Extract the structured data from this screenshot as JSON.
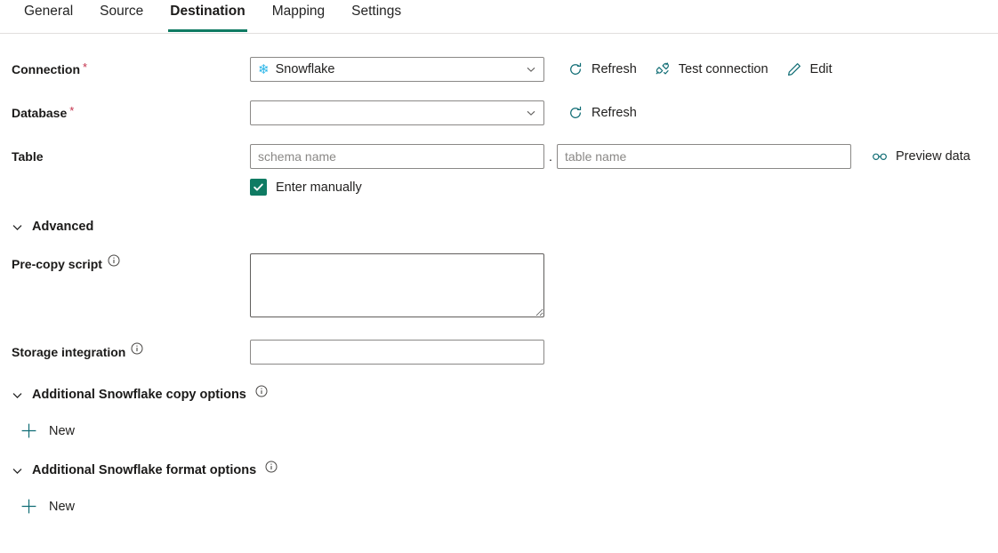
{
  "tabs": [
    {
      "label": "General",
      "active": false
    },
    {
      "label": "Source",
      "active": false
    },
    {
      "label": "Destination",
      "active": true
    },
    {
      "label": "Mapping",
      "active": false
    },
    {
      "label": "Settings",
      "active": false
    }
  ],
  "connection": {
    "label": "Connection",
    "required": true,
    "value": "Snowflake",
    "icon": "snowflake-icon",
    "dropdown_icon": "chevron-down-icon",
    "actions": [
      {
        "label": "Refresh",
        "icon": "refresh-icon"
      },
      {
        "label": "Test connection",
        "icon": "plug-check-icon"
      },
      {
        "label": "Edit",
        "icon": "pencil-icon"
      }
    ]
  },
  "database": {
    "label": "Database",
    "required": true,
    "value": "",
    "dropdown_icon": "chevron-down-icon",
    "actions": [
      {
        "label": "Refresh",
        "icon": "refresh-icon"
      }
    ]
  },
  "table": {
    "label": "Table",
    "required": false,
    "schema_value": "",
    "schema_placeholder": "schema name",
    "separator": ".",
    "table_value": "",
    "table_placeholder": "table name",
    "actions": [
      {
        "label": "Preview data",
        "icon": "glasses-icon"
      }
    ],
    "enter_manually": {
      "label": "Enter manually",
      "checked": true,
      "icon": "checkmark-icon"
    }
  },
  "advanced": {
    "label": "Advanced",
    "expanded": true,
    "chevron_icon": "chevron-down-icon"
  },
  "pre_copy_script": {
    "label": "Pre-copy script",
    "info_icon": "info-icon",
    "value": "",
    "placeholder": ""
  },
  "storage_integration": {
    "label": "Storage integration",
    "info_icon": "info-icon",
    "value": "",
    "placeholder": ""
  },
  "copy_options": {
    "label": "Additional Snowflake copy options",
    "expanded": true,
    "chevron_icon": "chevron-down-icon",
    "info_icon": "info-icon",
    "new_button": {
      "label": "New",
      "icon": "plus-icon"
    }
  },
  "format_options": {
    "label": "Additional Snowflake format options",
    "expanded": true,
    "chevron_icon": "chevron-down-icon",
    "info_icon": "info-icon",
    "new_button": {
      "label": "New",
      "icon": "plus-icon"
    }
  },
  "colors": {
    "accent_teal": "#0f7b63",
    "icon_teal": "#0f6c74",
    "snowflake_blue": "#29b5e8",
    "required_red": "#c4314b",
    "text": "#201f1e",
    "border": "#8a8886"
  }
}
